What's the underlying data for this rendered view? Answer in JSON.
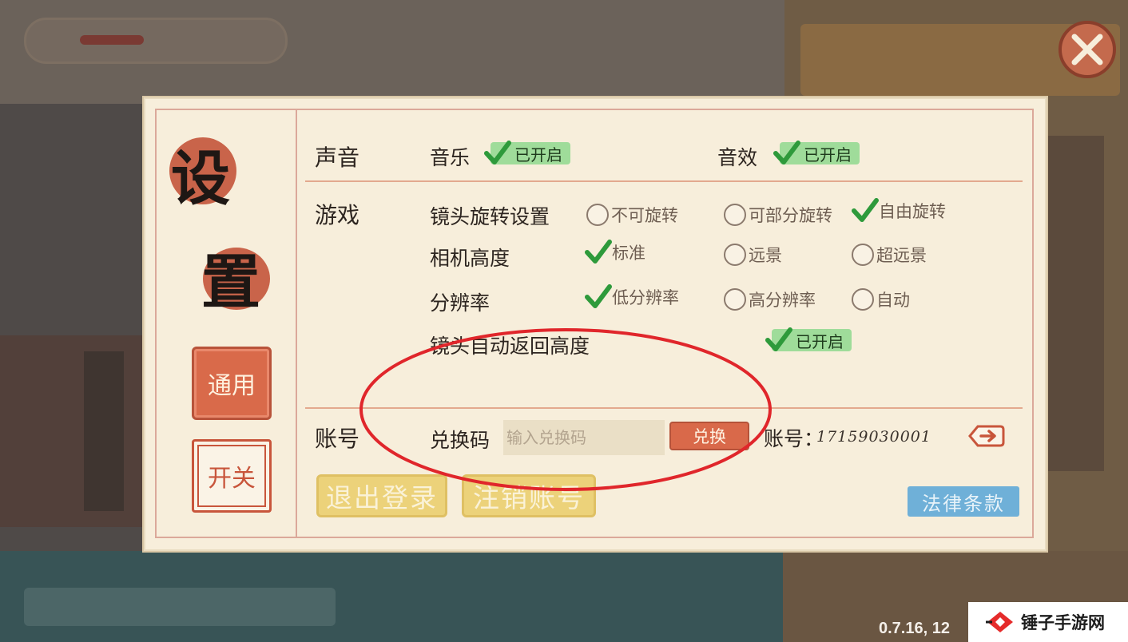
{
  "title": {
    "char1": "设",
    "char2": "置"
  },
  "tabs": [
    {
      "label": "通用",
      "active": true
    },
    {
      "label": "开关",
      "active": false
    }
  ],
  "sound": {
    "section": "声音",
    "music_label": "音乐",
    "music_state": "已开启",
    "sfx_label": "音效",
    "sfx_state": "已开启"
  },
  "game": {
    "section": "游戏",
    "camera_rotation": {
      "label": "镜头旋转设置",
      "options": [
        "不可旋转",
        "可部分旋转",
        "自由旋转"
      ],
      "selected": "自由旋转"
    },
    "camera_height": {
      "label": "相机高度",
      "options": [
        "标准",
        "远景",
        "超远景"
      ],
      "selected": "标准"
    },
    "resolution": {
      "label": "分辨率",
      "options": [
        "低分辨率",
        "高分辨率",
        "自动"
      ],
      "selected": "低分辨率"
    },
    "auto_return": {
      "label": "镜头自动返回高度",
      "state": "已开启"
    }
  },
  "account": {
    "section": "账号",
    "redeem_label": "兑换码",
    "redeem_placeholder": "输入兑换码",
    "redeem_button": "兑换",
    "account_label": "账号：",
    "account_id": "17159030001",
    "logout_button": "退出登录",
    "delete_button": "注销账号",
    "legal_button": "法律条款"
  },
  "footer": {
    "version": "0.7.16, 12",
    "watermark": "锤子手游网"
  },
  "colors": {
    "panel": "#f7eedb",
    "accent_red": "#d9694a",
    "toggle_green": "#9fdc9a",
    "yellow_button": "#ecd27a",
    "blue_button": "#6fb0d8",
    "annotation_red": "#e0262b"
  }
}
